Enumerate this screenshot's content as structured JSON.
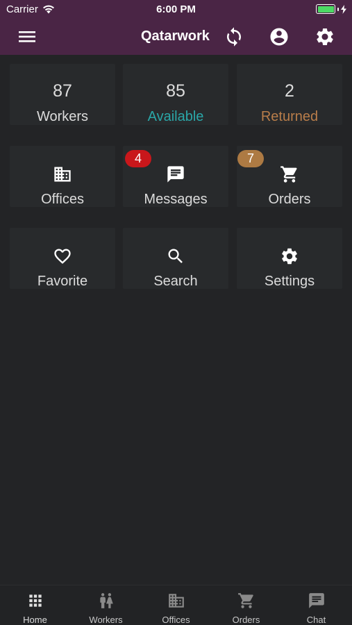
{
  "status_bar": {
    "carrier": "Carrier",
    "time": "6:00 PM",
    "battery_percent": 100,
    "charging": true
  },
  "app_bar": {
    "title": "Qatarwork",
    "icons": [
      "menu-icon",
      "sync-icon",
      "account-circle-icon",
      "settings-gear-icon"
    ],
    "color": "#4a2545"
  },
  "stats": [
    {
      "value": "87",
      "label": "Workers",
      "label_color": "#dcdcdc"
    },
    {
      "value": "85",
      "label": "Available",
      "label_color": "#2aa7a8"
    },
    {
      "value": "2",
      "label": "Returned",
      "label_color": "#b97d4a"
    }
  ],
  "tiles": [
    {
      "label": "Offices",
      "icon": "office-building-icon"
    },
    {
      "label": "Messages",
      "icon": "message-icon",
      "badge": "4",
      "badge_color": "#c9171b"
    },
    {
      "label": "Orders",
      "icon": "cart-icon",
      "badge": "7",
      "badge_color": "#ad7a43"
    },
    {
      "label": "Favorite",
      "icon": "heart-outline-icon"
    },
    {
      "label": "Search",
      "icon": "search-icon"
    },
    {
      "label": "Settings",
      "icon": "settings-gear-icon"
    }
  ],
  "bottom_nav": [
    {
      "label": "Home",
      "icon": "grid-icon",
      "active": true
    },
    {
      "label": "Workers",
      "icon": "workers-icon",
      "active": false
    },
    {
      "label": "Offices",
      "icon": "office-building-icon",
      "active": false
    },
    {
      "label": "Orders",
      "icon": "cart-icon",
      "active": false
    },
    {
      "label": "Chat",
      "icon": "chat-icon",
      "active": false
    }
  ]
}
